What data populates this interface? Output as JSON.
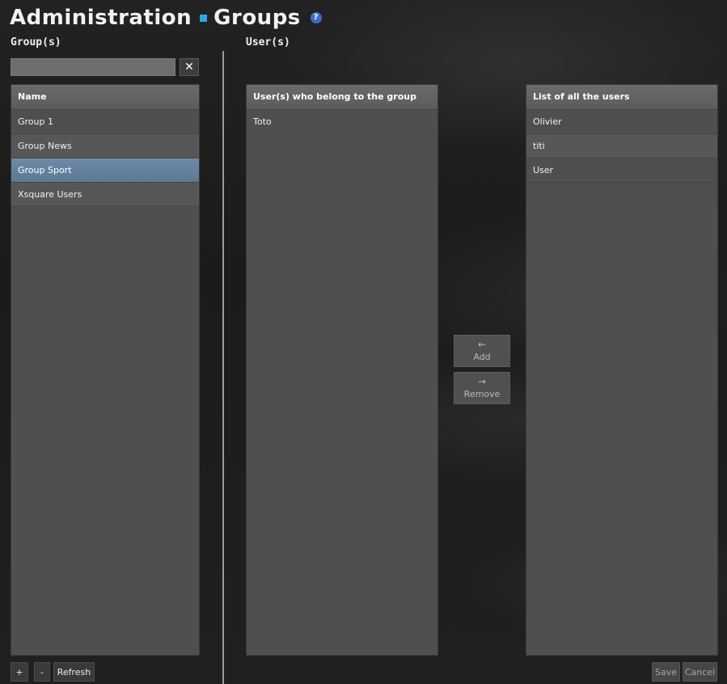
{
  "header": {
    "title_main": "Administration",
    "title_sub": "Groups",
    "help_icon": "?"
  },
  "groups_section": {
    "label": "Group(s)",
    "search": {
      "value": "",
      "placeholder": ""
    },
    "clear_icon": "✕",
    "column_header": "Name",
    "rows": [
      "Group 1",
      "Group News",
      "Group Sport",
      "Xsquare Users"
    ],
    "selected_index": 2,
    "buttons": {
      "add": "+",
      "remove": "-",
      "refresh": "Refresh"
    }
  },
  "users_section": {
    "label": "User(s)",
    "members_panel": {
      "header": "User(s) who belong to the group",
      "rows": [
        "Toto"
      ]
    },
    "all_users_panel": {
      "header": "List of all the users",
      "rows": [
        "Olivier",
        "titi",
        "User"
      ]
    },
    "add_button": {
      "arrow": "←",
      "label": "Add"
    },
    "remove_button": {
      "arrow": "→",
      "label": "Remove"
    },
    "save_label": "Save",
    "cancel_label": "Cancel"
  },
  "colors": {
    "accent": "#29a9e0",
    "selected_row": "#6f8aa6"
  }
}
